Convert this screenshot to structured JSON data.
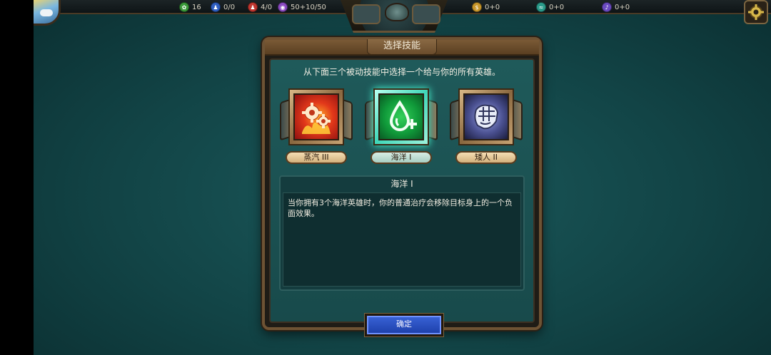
{
  "hud": {
    "resources": [
      {
        "icon": "coin-green-icon",
        "value": "16",
        "color": "#3a9a3a"
      },
      {
        "icon": "unit-blue-icon",
        "value": "0/0",
        "color": "#2f5fc0"
      },
      {
        "icon": "unit-red-icon",
        "value": "4/0",
        "color": "#c0362f"
      },
      {
        "icon": "population-purple-icon",
        "value": "50+10/50",
        "color": "#8a4ac0"
      },
      {
        "icon": "gold-icon",
        "value": "0+0",
        "color": "#c8962a"
      },
      {
        "icon": "teal-resource-icon",
        "value": "0+0",
        "color": "#2a9a8a"
      },
      {
        "icon": "purple-resource-icon",
        "value": "0+0",
        "color": "#6a4ac0"
      }
    ]
  },
  "dialog": {
    "title": "选择技能",
    "instruction": "从下面三个被动技能中选择一个给与你的所有英雄。",
    "skills": [
      {
        "name": "蒸汽 III",
        "icon": "gears-fire-icon",
        "selected": false
      },
      {
        "name": "海洋 I",
        "icon": "water-drop-plus-icon",
        "selected": true
      },
      {
        "name": "矮人 II",
        "icon": "stone-fist-icon",
        "selected": false
      }
    ],
    "description": {
      "title": "海洋 I",
      "text": "当你拥有3个海洋英雄时，你的普通治疗会移除目标身上的一个负面效果。"
    },
    "confirm_label": "确定"
  }
}
